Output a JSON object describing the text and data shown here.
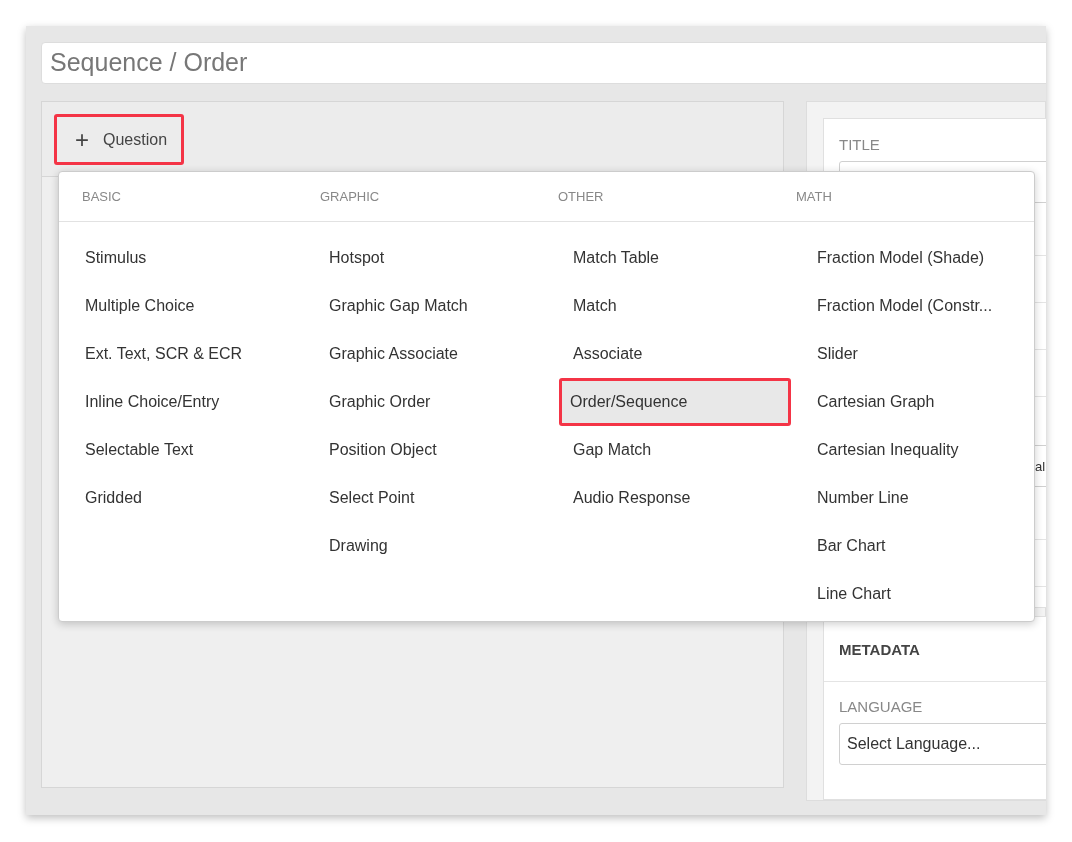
{
  "title_field": {
    "value": "Sequence / Order"
  },
  "add_button": {
    "icon": "+",
    "label": "Question",
    "annotated": true
  },
  "menu": {
    "columns": [
      {
        "heading": "BASIC",
        "items": [
          {
            "label": "Stimulus",
            "selected": false
          },
          {
            "label": "Multiple Choice",
            "selected": false
          },
          {
            "label": "Ext. Text, SCR & ECR",
            "selected": false
          },
          {
            "label": "Inline Choice/Entry",
            "selected": false
          },
          {
            "label": "Selectable Text",
            "selected": false
          },
          {
            "label": "Gridded",
            "selected": false
          }
        ]
      },
      {
        "heading": "GRAPHIC",
        "items": [
          {
            "label": "Hotspot",
            "selected": false
          },
          {
            "label": "Graphic Gap Match",
            "selected": false
          },
          {
            "label": "Graphic Associate",
            "selected": false
          },
          {
            "label": "Graphic Order",
            "selected": false
          },
          {
            "label": "Position Object",
            "selected": false
          },
          {
            "label": "Select Point",
            "selected": false
          },
          {
            "label": "Drawing",
            "selected": false
          }
        ]
      },
      {
        "heading": "OTHER",
        "items": [
          {
            "label": "Match Table",
            "selected": false
          },
          {
            "label": "Match",
            "selected": false
          },
          {
            "label": "Associate",
            "selected": false
          },
          {
            "label": "Order/Sequence",
            "selected": true
          },
          {
            "label": "Gap Match",
            "selected": false
          },
          {
            "label": "Audio Response",
            "selected": false
          }
        ]
      },
      {
        "heading": "MATH",
        "items": [
          {
            "label": "Fraction Model (Shade)",
            "selected": false
          },
          {
            "label": "Fraction Model (Constr...",
            "selected": false
          },
          {
            "label": "Slider",
            "selected": false
          },
          {
            "label": "Cartesian Graph",
            "selected": false
          },
          {
            "label": "Cartesian Inequality",
            "selected": false
          },
          {
            "label": "Number Line",
            "selected": false
          },
          {
            "label": "Bar Chart",
            "selected": false
          },
          {
            "label": "Line Chart",
            "selected": false
          }
        ]
      }
    ]
  },
  "side_panel": {
    "title_label": "TITLE",
    "hidden_field_fragment": "al",
    "metadata_heading": "METADATA",
    "language_label": "LANGUAGE",
    "language_select": {
      "value": "Select Language..."
    }
  }
}
